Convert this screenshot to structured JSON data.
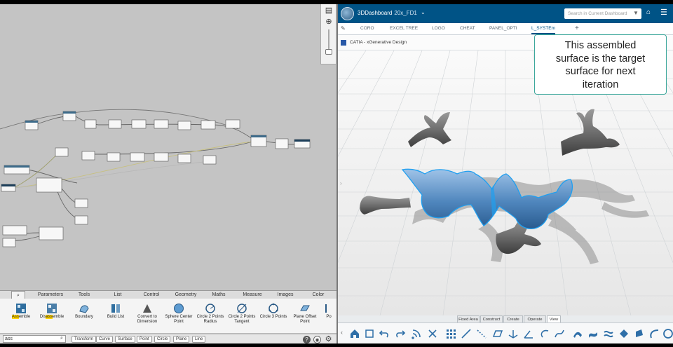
{
  "left_panel": {
    "tabs": [
      "",
      "Parameters",
      "Tools",
      "List",
      "Control",
      "Geometry",
      "Maths",
      "Measure",
      "Images",
      "Color"
    ],
    "selected_tab": 0,
    "ribbon": [
      {
        "label_pre": "",
        "label_hl": "Ass",
        "label_post": "emble",
        "icon": "assemble-icon"
      },
      {
        "label_pre": "Dis",
        "label_hl": "ass",
        "label_post": "emble",
        "icon": "disassemble-icon"
      },
      {
        "label_pre": "Boundary",
        "label_hl": "",
        "label_post": "",
        "icon": "boundary-icon"
      },
      {
        "label_pre": "Build List",
        "label_hl": "",
        "label_post": "",
        "icon": "build-list-icon"
      },
      {
        "label_pre": "Convert to Dimension",
        "label_hl": "",
        "label_post": "",
        "icon": "convert-dimension-icon"
      },
      {
        "label_pre": "Sphere Center Point",
        "label_hl": "",
        "label_post": "",
        "icon": "sphere-center-icon"
      },
      {
        "label_pre": "Circle 2 Points Radius",
        "label_hl": "",
        "label_post": "",
        "icon": "circle-radius-icon"
      },
      {
        "label_pre": "Circle 2 Points Tangent",
        "label_hl": "",
        "label_post": "",
        "icon": "circle-tangent-icon"
      },
      {
        "label_pre": "Circle 3 Points",
        "label_hl": "",
        "label_post": "",
        "icon": "circle-3pt-icon"
      },
      {
        "label_pre": "Plane Offset Point",
        "label_hl": "",
        "label_post": "",
        "icon": "plane-offset-icon"
      },
      {
        "label_pre": "Po",
        "label_hl": "",
        "label_post": "",
        "icon": "point-icon"
      }
    ],
    "search_value": "ass",
    "filter_chips": [
      "Transform",
      "Curve",
      "Surface",
      "Point",
      "Circle",
      "Plane",
      "Line"
    ]
  },
  "right_panel": {
    "brand": "3DDashboard",
    "dashboard_name": "20x_FD1",
    "search_placeholder": "Search in Current Dashboard",
    "dashboard_tabs": [
      "CORO",
      "EXCEL TREE",
      "LOGO",
      "CHEAT",
      "PANEL_OPTI",
      "L_SYSTEm"
    ],
    "selected_tab": 5,
    "add_tab": "+",
    "app_title": "CATIA - xGenerative Design",
    "callout_lines": [
      "This assembled",
      "surface is the target",
      "surface for next",
      "iteration"
    ],
    "section_tabs": [
      "Fixed Area",
      "Construct",
      "Create",
      "Operate",
      "View"
    ],
    "selected_section": 4
  },
  "colors": {
    "topbar": "#005386",
    "highlight": "#1e88e5",
    "callout_border": "#3ca79b"
  }
}
